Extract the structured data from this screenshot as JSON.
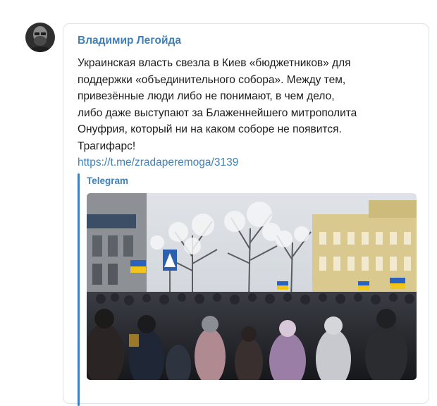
{
  "post": {
    "author": "Владимир Легойда",
    "text_lines": [
      "Украинская власть свезла в Киев «бюджетников» для",
      "поддержки «объединительного собора». Между тем,",
      "привезённые люди либо не понимают, в чем дело,",
      "либо даже выступают за Блаженнейшего митрополита",
      "Онуфрия, который ни на каком соборе не появится.",
      "Трагифарс!"
    ],
    "link": "https://t.me/zradaperemoga/3139",
    "preview": {
      "site_name": "Telegram"
    }
  },
  "colors": {
    "accent": "#3f80b8",
    "text": "#1b1b1b",
    "bubble_border": "#dde3ea"
  },
  "icons": {
    "avatar": "author-avatar",
    "photo": "crowd-street-photo"
  }
}
